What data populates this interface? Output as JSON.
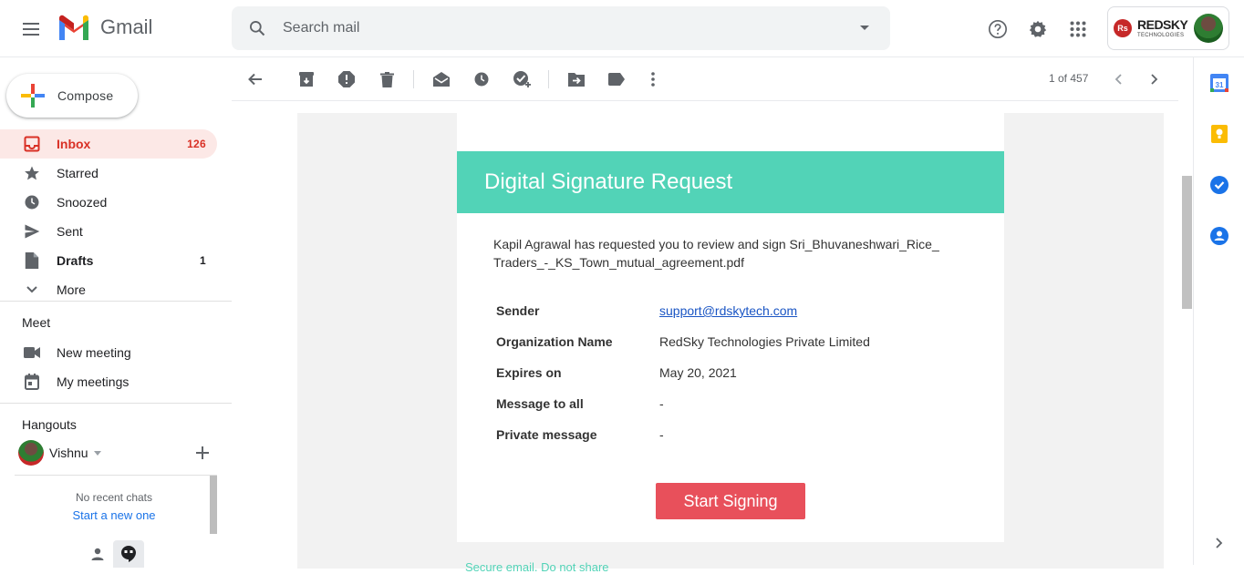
{
  "app": {
    "name": "Gmail",
    "search_placeholder": "Search mail"
  },
  "account": {
    "brand_badge": "Rs",
    "brand_name": "REDSKY",
    "brand_sub": "TECHNOLOGIES"
  },
  "sidebar": {
    "compose_label": "Compose",
    "items": [
      {
        "label": "Inbox",
        "count": "126",
        "icon": "inbox-icon"
      },
      {
        "label": "Starred",
        "count": "",
        "icon": "star-icon"
      },
      {
        "label": "Snoozed",
        "count": "",
        "icon": "clock-icon"
      },
      {
        "label": "Sent",
        "count": "",
        "icon": "send-icon"
      },
      {
        "label": "Drafts",
        "count": "1",
        "icon": "draft-icon"
      },
      {
        "label": "More",
        "count": "",
        "icon": "chevron-down-icon"
      }
    ],
    "meet": {
      "title": "Meet",
      "new_meeting": "New meeting",
      "my_meetings": "My meetings"
    },
    "hangouts": {
      "title": "Hangouts",
      "user": "Vishnu",
      "no_chats": "No recent chats",
      "start_new": "Start a new one"
    }
  },
  "toolbar": {
    "pager": "1 of 457"
  },
  "email": {
    "banner_title": "Digital Signature Request",
    "intro": "Kapil Agrawal has requested you to review and sign Sri_Bhuvaneshwari_Rice_ Traders_-_KS_Town_mutual_agreement.pdf",
    "rows": [
      {
        "label": "Sender",
        "value": "support@rdskytech.com"
      },
      {
        "label": "Organization Name",
        "value": "RedSky Technologies Private Limited"
      },
      {
        "label": "Expires on",
        "value": "May 20, 2021"
      },
      {
        "label": "Message to all",
        "value": "-"
      },
      {
        "label": "Private message",
        "value": "-"
      }
    ],
    "button_label": "Start Signing",
    "footer": "Secure email. Do not share"
  },
  "colors": {
    "banner": "#52d3b7",
    "button": "#e8505b",
    "inbox_active": "#fce8e6",
    "inbox_text": "#d93025"
  }
}
